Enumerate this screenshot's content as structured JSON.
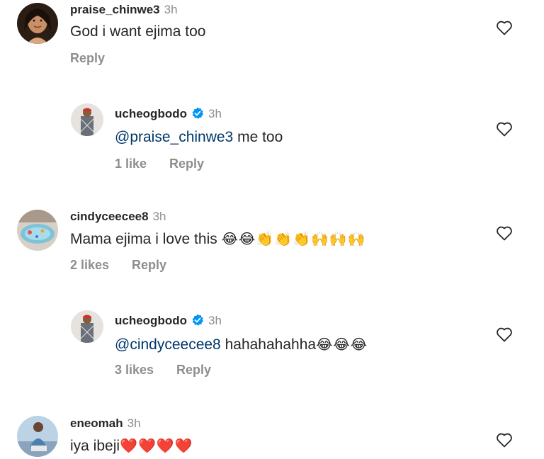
{
  "comments": [
    {
      "username": "praise_chinwe3",
      "time": "3h",
      "text": "God i want ejima too",
      "reply_label": "Reply",
      "avatar_icon": "avatar-woman-photo"
    },
    {
      "username": "ucheogbodo",
      "time": "3h",
      "mention": "@praise_chinwe3",
      "text": " me too",
      "likes": "1 like",
      "reply_label": "Reply",
      "avatar_icon": "avatar-man-photo"
    },
    {
      "username": "cindyceecee8",
      "time": "3h",
      "text": "Mama ejima i love this ",
      "emojis": "😂😂👏👏👏🙌🙌🙌",
      "likes": "2 likes",
      "reply_label": "Reply",
      "avatar_icon": "avatar-pool-photo"
    },
    {
      "username": "ucheogbodo",
      "time": "3h",
      "mention": "@cindyceecee8",
      "text": " hahahahahha",
      "emojis": "😂😂😂",
      "likes": "3 likes",
      "reply_label": "Reply",
      "avatar_icon": "avatar-man-photo"
    },
    {
      "username": "eneomah",
      "time": "3h",
      "text": "iya ibeji",
      "emojis": "❤️❤️❤️❤️",
      "avatar_icon": "avatar-woman-seated-photo"
    }
  ],
  "colors": {
    "text": "#262626",
    "muted": "#8e8e8e",
    "mention": "#00376b",
    "verified": "#0095f6"
  }
}
